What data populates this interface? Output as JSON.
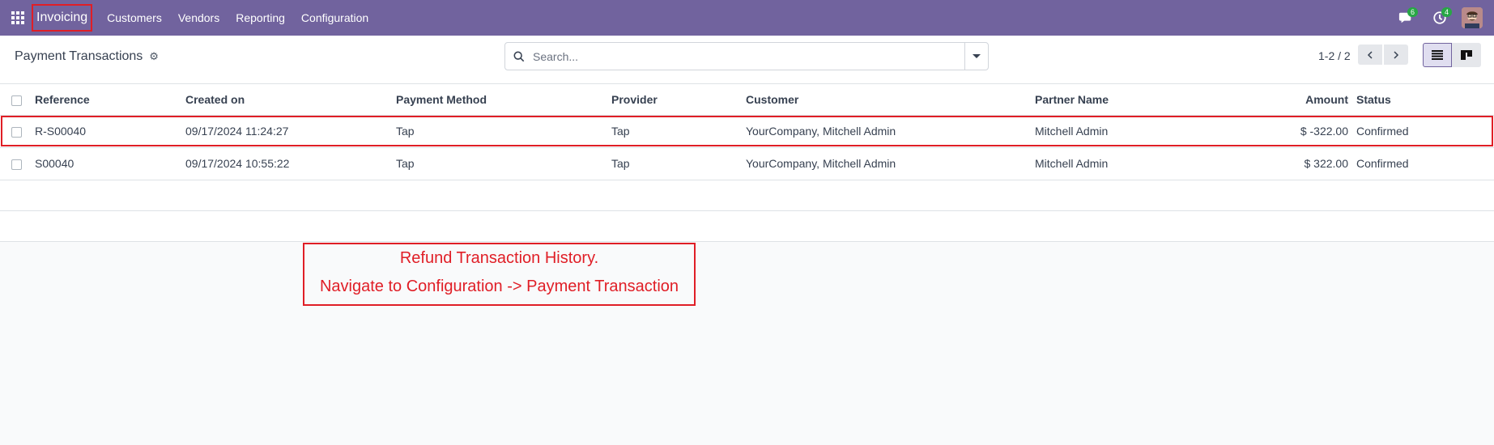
{
  "navbar": {
    "app_name": "Invoicing",
    "menu": [
      "Customers",
      "Vendors",
      "Reporting",
      "Configuration"
    ],
    "messages_count": "6",
    "activities_count": "4",
    "brand_color": "#71639e"
  },
  "control_panel": {
    "title": "Payment Transactions",
    "search_placeholder": "Search...",
    "pager": "1-2 / 2"
  },
  "table": {
    "headers": {
      "reference": "Reference",
      "created_on": "Created on",
      "payment_method": "Payment Method",
      "provider": "Provider",
      "customer": "Customer",
      "partner_name": "Partner Name",
      "amount": "Amount",
      "status": "Status"
    },
    "rows": [
      {
        "reference": "R-S00040",
        "created_on": "09/17/2024 11:24:27",
        "payment_method": "Tap",
        "provider": "Tap",
        "customer": "YourCompany, Mitchell Admin",
        "partner_name": "Mitchell Admin",
        "amount": "$ -322.00",
        "status": "Confirmed"
      },
      {
        "reference": "S00040",
        "created_on": "09/17/2024 10:55:22",
        "payment_method": "Tap",
        "provider": "Tap",
        "customer": "YourCompany, Mitchell Admin",
        "partner_name": "Mitchell Admin",
        "amount": "$ 322.00",
        "status": "Confirmed"
      }
    ]
  },
  "annotation": {
    "line1": "Refund Transaction History.",
    "line2": "Navigate to Configuration -> Payment Transaction",
    "color": "#e01e26"
  }
}
